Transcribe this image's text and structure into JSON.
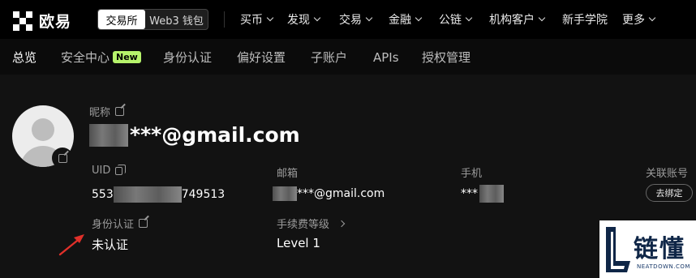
{
  "header": {
    "brand": "欧易",
    "segment": {
      "active": "交易所",
      "other": "Web3 钱包"
    },
    "nav": [
      {
        "label": "买币",
        "dropdown": true
      },
      {
        "label": "发现",
        "dropdown": true
      },
      {
        "label": "交易",
        "dropdown": true
      },
      {
        "label": "金融",
        "dropdown": true
      },
      {
        "label": "公链",
        "dropdown": true
      },
      {
        "label": "机构客户",
        "dropdown": true
      },
      {
        "label": "新手学院",
        "dropdown": false
      },
      {
        "label": "更多",
        "dropdown": true
      }
    ]
  },
  "tabs": [
    {
      "label": "总览",
      "active": true
    },
    {
      "label": "安全中心",
      "badge": "New"
    },
    {
      "label": "身份认证"
    },
    {
      "label": "偏好设置"
    },
    {
      "label": "子账户"
    },
    {
      "label": "APIs"
    },
    {
      "label": "授权管理"
    }
  ],
  "profile": {
    "nickname_label": "昵称",
    "nickname_value": "***@gmail.com",
    "uid_label": "UID",
    "uid_prefix": "553",
    "uid_suffix": "749513",
    "email_label": "邮箱",
    "email_value": "***@gmail.com",
    "phone_label": "手机",
    "phone_value": "***",
    "linked_label": "关联账号",
    "linked_button": "去绑定",
    "kyc_label": "身份认证",
    "kyc_value": "未认证",
    "fee_label": "手续费等级",
    "fee_value": "Level 1"
  },
  "watermark": {
    "title": "链懂",
    "sub": "NEATDOWN.COM"
  },
  "colors": {
    "badge": "#b6f36b",
    "arrow": "#e0302a",
    "watermark_text": "#0f2647"
  }
}
